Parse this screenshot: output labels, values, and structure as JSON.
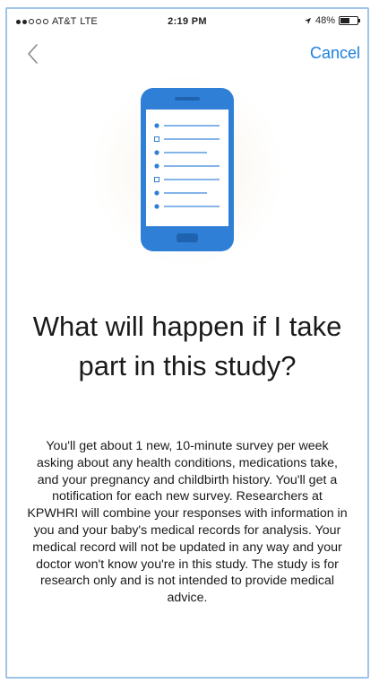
{
  "status_bar": {
    "carrier": "AT&T",
    "network": "LTE",
    "time": "2:19 PM",
    "battery": "48%",
    "battery_level": 0.48
  },
  "nav": {
    "back_icon": "chevron-left-icon",
    "cancel_label": "Cancel"
  },
  "content": {
    "illustration_icon": "phone-checklist-icon",
    "title": "What will happen if I take part in this study?",
    "body": "You'll get about 1 new, 10-minute survey per week asking about any health conditions, medications take, and your pregnancy and childbirth history. You'll get a notification for each new survey. Researchers at KPWHRI will combine your responses with information in you and your baby's medical records for analysis. Your medical record will not be updated in any way and your doctor won't know you're in this study. The study is for research only and is not intended to provide medical advice."
  },
  "colors": {
    "accent": "#1a7fe0",
    "phone": "#2f7fd6",
    "frame_border": "#9fc4e8"
  }
}
